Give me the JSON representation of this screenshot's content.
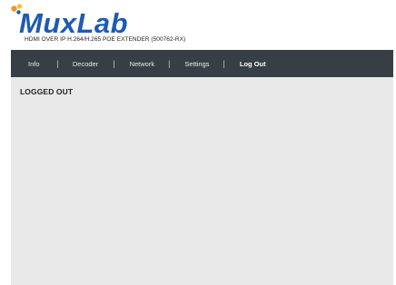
{
  "brand": {
    "name": "MuxLab",
    "subtitle": "HDMI OVER IP H.264/H.265 POE EXTENDER (500762-RX)",
    "colors": {
      "logo_blue": "#1d5bb3",
      "dot_orange": "#f0962a",
      "dot_yellow": "#f3c12b"
    }
  },
  "nav": {
    "background": "#373e45",
    "items": [
      {
        "label": "Info"
      },
      {
        "label": "Decoder"
      },
      {
        "label": "Network"
      },
      {
        "label": "Settings"
      },
      {
        "label": "Log Out"
      }
    ],
    "separator": "|"
  },
  "main": {
    "title": "LOGGED OUT"
  }
}
